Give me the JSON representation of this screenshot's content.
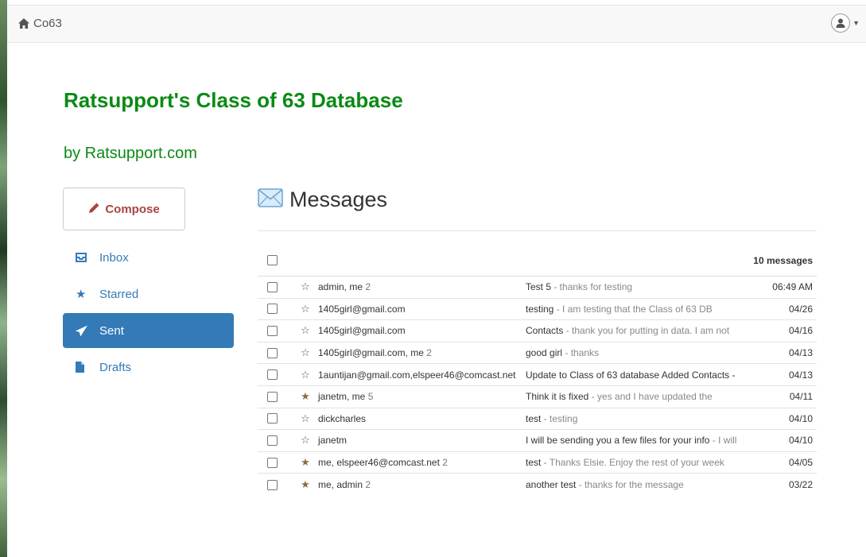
{
  "navbar": {
    "brand": "Co63"
  },
  "header": {
    "title": "Ratsupport's Class of 63 Database",
    "subtitle": "by Ratsupport.com"
  },
  "sidebar": {
    "compose_label": "Compose",
    "items": [
      {
        "label": "Inbox",
        "icon": "inbox-icon"
      },
      {
        "label": "Starred",
        "icon": "star-icon"
      },
      {
        "label": "Sent",
        "icon": "send-icon",
        "active": true
      },
      {
        "label": "Drafts",
        "icon": "file-icon"
      }
    ]
  },
  "main": {
    "heading": "Messages",
    "count": "10 messages",
    "messages": [
      {
        "from": "admin, me",
        "num": "2",
        "subject": "Test 5",
        "preview": " - thanks for testing",
        "date": "06:49 AM",
        "starred": false
      },
      {
        "from": "1405girl@gmail.com",
        "num": "",
        "subject": "testing",
        "preview": " - I am testing that the Class of 63 DB",
        "date": "04/26",
        "starred": false
      },
      {
        "from": "1405girl@gmail.com",
        "num": "",
        "subject": "Contacts",
        "preview": " - thank you for putting in data. I am not",
        "date": "04/16",
        "starred": false
      },
      {
        "from": "1405girl@gmail.com, me",
        "num": "2",
        "subject": "good girl",
        "preview": " - thanks",
        "date": "04/13",
        "starred": false
      },
      {
        "from": "1auntijan@gmail.com,elspeer46@comcast.net",
        "num": "",
        "subject": "Update to Class of 63 database Added Contacts -",
        "preview": "",
        "date": "04/13",
        "starred": false
      },
      {
        "from": "janetm, me",
        "num": "5",
        "subject": "Think it is fixed",
        "preview": " - yes and I have updated the",
        "date": "04/11",
        "starred": true
      },
      {
        "from": "dickcharles",
        "num": "",
        "subject": "test",
        "preview": " - testing",
        "date": "04/10",
        "starred": false
      },
      {
        "from": "janetm",
        "num": "",
        "subject": "I will be sending you a few files for your info",
        "preview": " - I will",
        "date": "04/10",
        "starred": false
      },
      {
        "from": "me, elspeer46@comcast.net",
        "num": "2",
        "subject": "test",
        "preview": " - Thanks Elsie. Enjoy the rest of your week",
        "date": "04/05",
        "starred": true
      },
      {
        "from": "me, admin",
        "num": "2",
        "subject": "another test",
        "preview": " - thanks for the message",
        "date": "03/22",
        "starred": true
      }
    ]
  },
  "colors": {
    "title_green": "#0a8a15",
    "accent_blue": "#337ab7",
    "compose_red": "#a94442"
  }
}
